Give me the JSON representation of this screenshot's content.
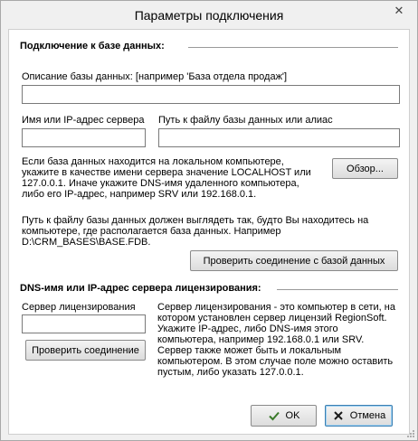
{
  "window": {
    "title": "Параметры подключения",
    "close_glyph": "✕"
  },
  "db_section": {
    "title": "Подключение к базе данных:",
    "description_label": "Описание базы данных: [например 'База отдела продаж']",
    "description_value": "",
    "server_label": "Имя или IP-адрес сервера",
    "server_value": "",
    "path_label": "Путь к файлу базы данных или алиас",
    "path_value": "",
    "hint1_lines": [
      "Если база данных находится на локальном компьютере,",
      "укажите в качестве имени сервера значение LOCALHOST или",
      "127.0.0.1. Иначе укажите DNS-имя удаленного компьютера,",
      "либо его IP-адрес, например SRV или 192.168.0.1."
    ],
    "browse_button": "Обзор...",
    "hint2_lines": [
      "Путь к файлу базы данных должен выглядеть так, будто Вы находитесь на",
      "компьютере, где располагается база данных. Например",
      "D:\\CRM_BASES\\BASE.FDB."
    ],
    "check_db_button": "Проверить соединение с базой данных"
  },
  "license_section": {
    "title": "DNS-имя или IP-адрес сервера лицензирования:",
    "server_label": "Сервер лицензирования",
    "server_value": "",
    "check_button": "Проверить соединение",
    "hint_lines": [
      "Сервер лицензирования - это компьютер в сети, на",
      "котором установлен сервер лицензий RegionSoft.",
      "Укажите IP-адрес, либо DNS-имя этого",
      "компьютера, например 192.168.0.1 или SRV.",
      "Сервер также может быть и локальным",
      "компьютером. В этом случае поле можно оставить",
      "пустым, либо указать 127.0.0.1."
    ]
  },
  "footer": {
    "ok_button": "OK",
    "cancel_button": "Отмена"
  },
  "colors": {
    "ok_check": "#3a7a2a",
    "cancel_x": "#1a1a1a",
    "accent_border": "#3c7fb1"
  },
  "icons": {
    "ok": "check-icon",
    "cancel": "x-icon",
    "close": "close-icon"
  }
}
